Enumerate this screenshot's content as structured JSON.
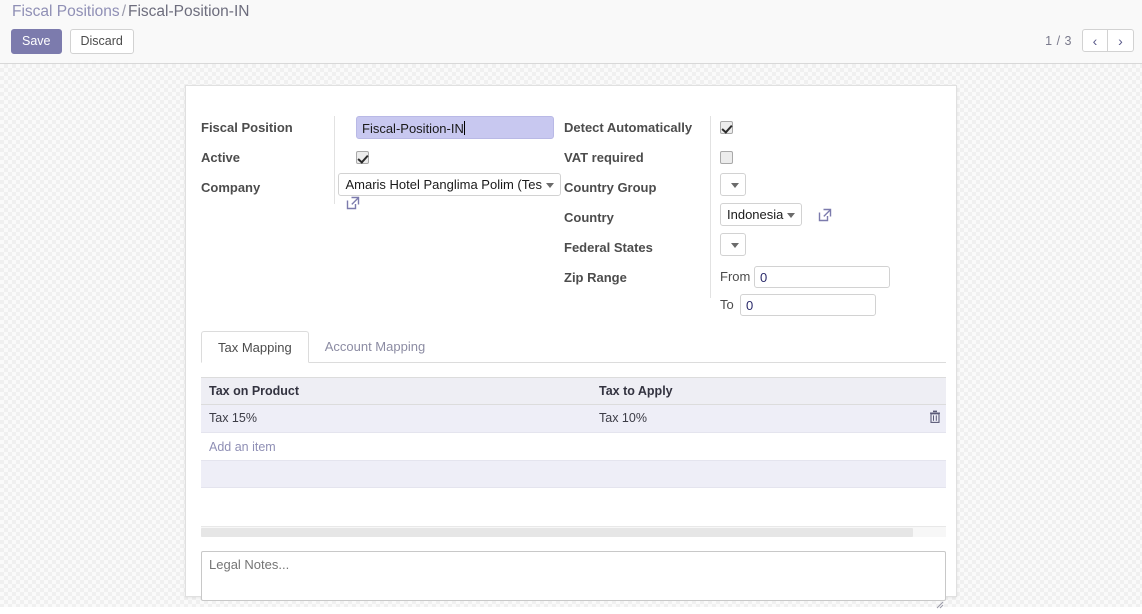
{
  "breadcrumb": {
    "root": "Fiscal Positions",
    "separator": "/",
    "current": "Fiscal-Position-IN"
  },
  "toolbar": {
    "save_label": "Save",
    "discard_label": "Discard"
  },
  "pager": {
    "count": "1 / 3",
    "prev_icon": "chevron-left-icon",
    "next_icon": "chevron-right-icon",
    "prev_glyph": "‹",
    "next_glyph": "›"
  },
  "form": {
    "left": {
      "fiscal_position_label": "Fiscal Position",
      "fiscal_position_value": "Fiscal-Position-IN",
      "active_label": "Active",
      "active_checked": true,
      "company_label": "Company",
      "company_value": "Amaris Hotel Panglima Polim (Tes"
    },
    "right": {
      "detect_automatically_label": "Detect Automatically",
      "detect_automatically_checked": true,
      "vat_required_label": "VAT required",
      "vat_required_checked": false,
      "country_group_label": "Country Group",
      "country_group_value": "",
      "country_label": "Country",
      "country_value": "Indonesia",
      "federal_states_label": "Federal States",
      "federal_states_value": "",
      "zip_range_label": "Zip Range",
      "zip_from_prefix": "From",
      "zip_from_value": "0",
      "zip_to_prefix": "To",
      "zip_to_value": "0"
    }
  },
  "notebook": {
    "tabs": [
      {
        "label": "Tax Mapping",
        "active": true
      },
      {
        "label": "Account Mapping",
        "active": false
      }
    ],
    "table": {
      "headers": [
        "Tax on Product",
        "Tax to Apply"
      ],
      "rows": [
        {
          "tax_on_product": "Tax 15%",
          "tax_to_apply": "Tax 10%",
          "delete_icon": "trash-icon"
        }
      ],
      "add_item_label": "Add an item"
    }
  },
  "notes": {
    "placeholder": "Legal Notes..."
  },
  "colors": {
    "accent": "#7c7bad",
    "breadcrumb_link": "#8f8fb5",
    "row_bg": "#eeeef7",
    "header_bg": "#eeeef4",
    "selected_input_bg": "#c8c8f0"
  }
}
